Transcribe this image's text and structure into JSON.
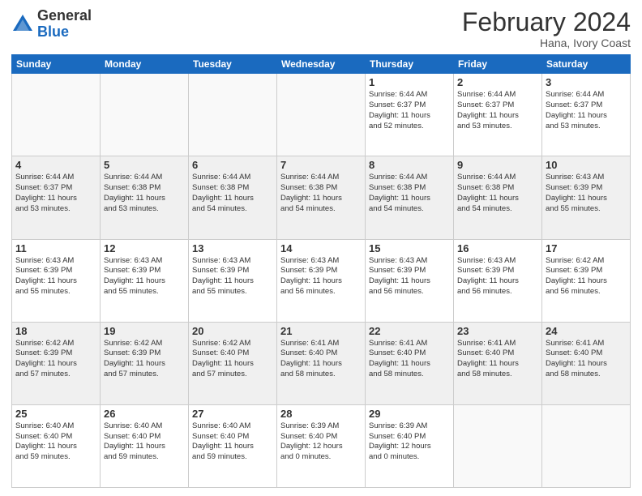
{
  "logo": {
    "general": "General",
    "blue": "Blue"
  },
  "title": "February 2024",
  "location": "Hana, Ivory Coast",
  "days_of_week": [
    "Sunday",
    "Monday",
    "Tuesday",
    "Wednesday",
    "Thursday",
    "Friday",
    "Saturday"
  ],
  "weeks": [
    {
      "shaded": false,
      "days": [
        {
          "num": "",
          "empty": true,
          "info": ""
        },
        {
          "num": "",
          "empty": true,
          "info": ""
        },
        {
          "num": "",
          "empty": true,
          "info": ""
        },
        {
          "num": "",
          "empty": true,
          "info": ""
        },
        {
          "num": "1",
          "empty": false,
          "info": "Sunrise: 6:44 AM\nSunset: 6:37 PM\nDaylight: 11 hours\nand 52 minutes."
        },
        {
          "num": "2",
          "empty": false,
          "info": "Sunrise: 6:44 AM\nSunset: 6:37 PM\nDaylight: 11 hours\nand 53 minutes."
        },
        {
          "num": "3",
          "empty": false,
          "info": "Sunrise: 6:44 AM\nSunset: 6:37 PM\nDaylight: 11 hours\nand 53 minutes."
        }
      ]
    },
    {
      "shaded": true,
      "days": [
        {
          "num": "4",
          "empty": false,
          "info": "Sunrise: 6:44 AM\nSunset: 6:37 PM\nDaylight: 11 hours\nand 53 minutes."
        },
        {
          "num": "5",
          "empty": false,
          "info": "Sunrise: 6:44 AM\nSunset: 6:38 PM\nDaylight: 11 hours\nand 53 minutes."
        },
        {
          "num": "6",
          "empty": false,
          "info": "Sunrise: 6:44 AM\nSunset: 6:38 PM\nDaylight: 11 hours\nand 54 minutes."
        },
        {
          "num": "7",
          "empty": false,
          "info": "Sunrise: 6:44 AM\nSunset: 6:38 PM\nDaylight: 11 hours\nand 54 minutes."
        },
        {
          "num": "8",
          "empty": false,
          "info": "Sunrise: 6:44 AM\nSunset: 6:38 PM\nDaylight: 11 hours\nand 54 minutes."
        },
        {
          "num": "9",
          "empty": false,
          "info": "Sunrise: 6:44 AM\nSunset: 6:38 PM\nDaylight: 11 hours\nand 54 minutes."
        },
        {
          "num": "10",
          "empty": false,
          "info": "Sunrise: 6:43 AM\nSunset: 6:39 PM\nDaylight: 11 hours\nand 55 minutes."
        }
      ]
    },
    {
      "shaded": false,
      "days": [
        {
          "num": "11",
          "empty": false,
          "info": "Sunrise: 6:43 AM\nSunset: 6:39 PM\nDaylight: 11 hours\nand 55 minutes."
        },
        {
          "num": "12",
          "empty": false,
          "info": "Sunrise: 6:43 AM\nSunset: 6:39 PM\nDaylight: 11 hours\nand 55 minutes."
        },
        {
          "num": "13",
          "empty": false,
          "info": "Sunrise: 6:43 AM\nSunset: 6:39 PM\nDaylight: 11 hours\nand 55 minutes."
        },
        {
          "num": "14",
          "empty": false,
          "info": "Sunrise: 6:43 AM\nSunset: 6:39 PM\nDaylight: 11 hours\nand 56 minutes."
        },
        {
          "num": "15",
          "empty": false,
          "info": "Sunrise: 6:43 AM\nSunset: 6:39 PM\nDaylight: 11 hours\nand 56 minutes."
        },
        {
          "num": "16",
          "empty": false,
          "info": "Sunrise: 6:43 AM\nSunset: 6:39 PM\nDaylight: 11 hours\nand 56 minutes."
        },
        {
          "num": "17",
          "empty": false,
          "info": "Sunrise: 6:42 AM\nSunset: 6:39 PM\nDaylight: 11 hours\nand 56 minutes."
        }
      ]
    },
    {
      "shaded": true,
      "days": [
        {
          "num": "18",
          "empty": false,
          "info": "Sunrise: 6:42 AM\nSunset: 6:39 PM\nDaylight: 11 hours\nand 57 minutes."
        },
        {
          "num": "19",
          "empty": false,
          "info": "Sunrise: 6:42 AM\nSunset: 6:39 PM\nDaylight: 11 hours\nand 57 minutes."
        },
        {
          "num": "20",
          "empty": false,
          "info": "Sunrise: 6:42 AM\nSunset: 6:40 PM\nDaylight: 11 hours\nand 57 minutes."
        },
        {
          "num": "21",
          "empty": false,
          "info": "Sunrise: 6:41 AM\nSunset: 6:40 PM\nDaylight: 11 hours\nand 58 minutes."
        },
        {
          "num": "22",
          "empty": false,
          "info": "Sunrise: 6:41 AM\nSunset: 6:40 PM\nDaylight: 11 hours\nand 58 minutes."
        },
        {
          "num": "23",
          "empty": false,
          "info": "Sunrise: 6:41 AM\nSunset: 6:40 PM\nDaylight: 11 hours\nand 58 minutes."
        },
        {
          "num": "24",
          "empty": false,
          "info": "Sunrise: 6:41 AM\nSunset: 6:40 PM\nDaylight: 11 hours\nand 58 minutes."
        }
      ]
    },
    {
      "shaded": false,
      "days": [
        {
          "num": "25",
          "empty": false,
          "info": "Sunrise: 6:40 AM\nSunset: 6:40 PM\nDaylight: 11 hours\nand 59 minutes."
        },
        {
          "num": "26",
          "empty": false,
          "info": "Sunrise: 6:40 AM\nSunset: 6:40 PM\nDaylight: 11 hours\nand 59 minutes."
        },
        {
          "num": "27",
          "empty": false,
          "info": "Sunrise: 6:40 AM\nSunset: 6:40 PM\nDaylight: 11 hours\nand 59 minutes."
        },
        {
          "num": "28",
          "empty": false,
          "info": "Sunrise: 6:39 AM\nSunset: 6:40 PM\nDaylight: 12 hours\nand 0 minutes."
        },
        {
          "num": "29",
          "empty": false,
          "info": "Sunrise: 6:39 AM\nSunset: 6:40 PM\nDaylight: 12 hours\nand 0 minutes."
        },
        {
          "num": "",
          "empty": true,
          "info": ""
        },
        {
          "num": "",
          "empty": true,
          "info": ""
        }
      ]
    }
  ]
}
